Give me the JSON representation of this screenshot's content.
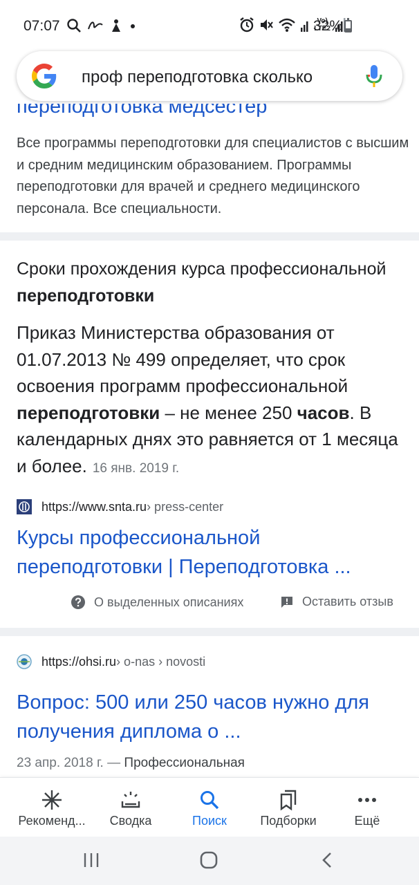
{
  "status_bar": {
    "time": "07:07",
    "battery": "32%",
    "battery_level": 0.32,
    "icons_left": [
      "search-icon",
      "scribble-icon",
      "notification-icon",
      "dot-icon"
    ],
    "icons_right": [
      "alarm-icon",
      "mute-icon",
      "wifi-icon",
      "signal-icon",
      "volte-lte2-icon",
      "signal-icon"
    ],
    "volte_line1": "Vo)",
    "volte_line2": "LTE2"
  },
  "search": {
    "query": "проф переподготовка сколько"
  },
  "result1": {
    "title_partial": "переподготовка медсестер",
    "snippet": "Все программы переподготовки для специалистов с высшим и средним медицинским образованием. Программы переподготовки для врачей и среднего медицинского персонала. Все специальности."
  },
  "featured_snippet": {
    "heading_a": "Сроки прохождения курса профессиональной ",
    "heading_bold": "переподготовки",
    "body_a": "Приказ Министерства образования от 01.07.2013 № 499 определяет, что срок освоения программ профессиональной ",
    "body_bold1": "переподготовки",
    "body_b": " – не менее 250 ",
    "body_bold2": "часов",
    "body_c": ". В календарных днях это равняется от 1 месяца и более.",
    "date": "16 янв. 2019 г.",
    "source_url": "https://www.snta.ru",
    "source_path": " › press-center",
    "link_title": "Курсы профессиональной переподготовки | Переподготовка ...",
    "about_label": "О выделенных описаниях",
    "feedback_label": "Оставить отзыв"
  },
  "result3": {
    "source_url": "https://ohsi.ru",
    "source_path": " › o-nas › novosti",
    "title": "Вопрос: 500 или 250 часов нужно для получения диплома о ...",
    "date": "23 апр. 2018 г.",
    "dash": " — ",
    "snippet_start": "Профессиональная"
  },
  "bottom_nav": {
    "items": [
      {
        "label": "Рекоменд...",
        "icon": "asterisk-icon"
      },
      {
        "label": "Сводка",
        "icon": "sunrise-icon"
      },
      {
        "label": "Поиск",
        "icon": "search-icon"
      },
      {
        "label": "Подборки",
        "icon": "collections-icon"
      },
      {
        "label": "Ещё",
        "icon": "more-dots-icon"
      }
    ],
    "active_index": 2
  },
  "system_nav": [
    "recent-apps-icon",
    "home-icon",
    "back-icon"
  ],
  "colors": {
    "link": "#1a56c9",
    "active_nav": "#1a73e8",
    "divider": "#eef0f3"
  }
}
